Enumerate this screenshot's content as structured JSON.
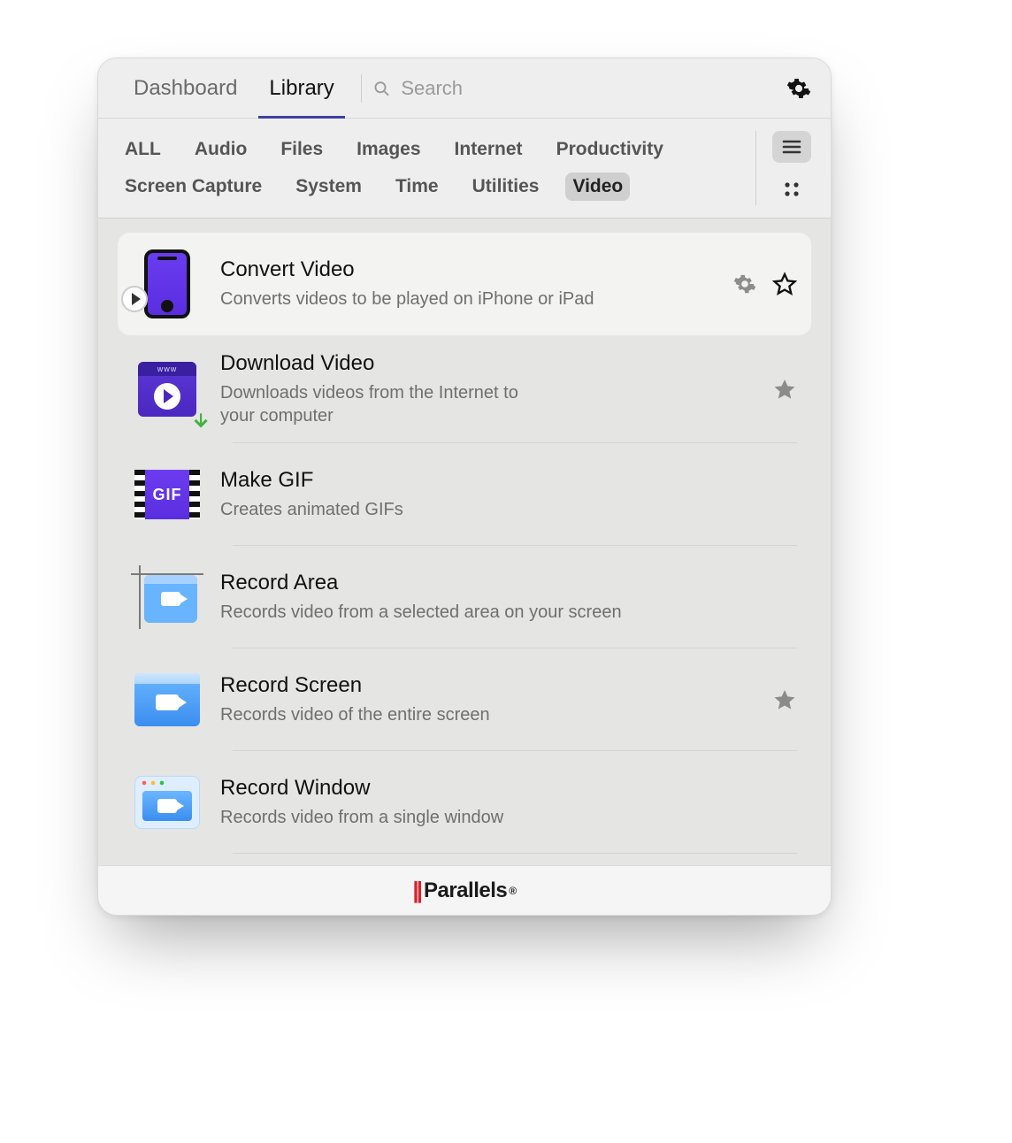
{
  "header": {
    "tabs": [
      {
        "id": "dashboard",
        "label": "Dashboard",
        "active": false
      },
      {
        "id": "library",
        "label": "Library",
        "active": true
      }
    ],
    "search_placeholder": "Search"
  },
  "categories": [
    {
      "id": "all",
      "label": "ALL"
    },
    {
      "id": "audio",
      "label": "Audio"
    },
    {
      "id": "files",
      "label": "Files"
    },
    {
      "id": "images",
      "label": "Images"
    },
    {
      "id": "internet",
      "label": "Internet"
    },
    {
      "id": "productivity",
      "label": "Productivity"
    },
    {
      "id": "screen-capture",
      "label": "Screen Capture"
    },
    {
      "id": "system",
      "label": "System"
    },
    {
      "id": "time",
      "label": "Time"
    },
    {
      "id": "utilities",
      "label": "Utilities"
    },
    {
      "id": "video",
      "label": "Video",
      "active": true
    }
  ],
  "view_mode": "list",
  "tools": [
    {
      "id": "convert-video",
      "title": "Convert Video",
      "desc": "Converts videos to be played on iPhone or iPad",
      "icon": "convert",
      "hovered": true,
      "show_gear": true,
      "star": "outline"
    },
    {
      "id": "download-video",
      "title": "Download Video",
      "desc": "Downloads videos from the Internet to your computer",
      "icon": "download",
      "star": "filled"
    },
    {
      "id": "make-gif",
      "title": "Make GIF",
      "desc": "Creates animated GIFs",
      "icon": "gif"
    },
    {
      "id": "record-area",
      "title": "Record Area",
      "desc": "Records video from a selected area on your screen",
      "icon": "area"
    },
    {
      "id": "record-screen",
      "title": "Record Screen",
      "desc": "Records video of the entire screen",
      "icon": "screen",
      "star": "filled"
    },
    {
      "id": "record-window",
      "title": "Record Window",
      "desc": "Records video from a single window",
      "icon": "window"
    }
  ],
  "footer_brand": "Parallels"
}
